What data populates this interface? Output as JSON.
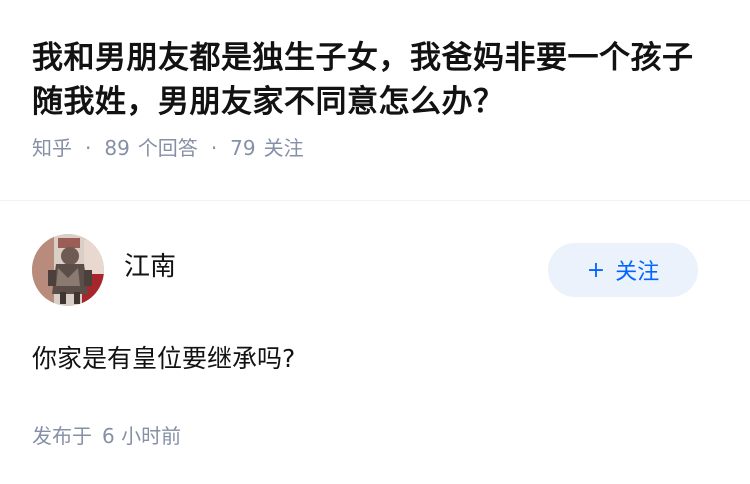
{
  "question": {
    "title": "我和男朋友都是独生子女，我爸妈非要一个孩子随我姓，男朋友家不同意怎么办？",
    "source": "知乎",
    "answer_count": "89",
    "answer_label": "个回答",
    "follower_count": "79",
    "follower_label": "关注"
  },
  "answer": {
    "author_name": "江南",
    "follow_label": "关注",
    "follow_plus": "+",
    "content": "你家是有皇位要继承吗?",
    "time_prefix": "发布于",
    "time_value": "6 小时前"
  },
  "colors": {
    "accent": "#0066ff",
    "follow_bg": "#ebf2fb",
    "meta_gray": "#8590a6",
    "text": "#121212"
  },
  "icons": {
    "avatar": "figurine-photo-avatar"
  }
}
